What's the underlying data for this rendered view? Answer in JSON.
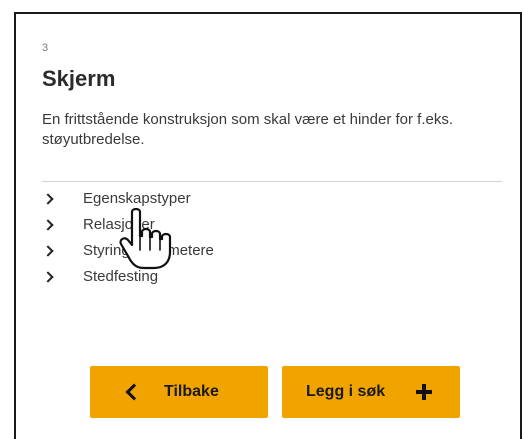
{
  "object": {
    "index": "3",
    "title": "Skjerm",
    "description": "En frittstående konstruksjon som skal være et hinder for f.eks. støyutbredelse."
  },
  "accordion": {
    "items": [
      {
        "label": "Egenskapstyper",
        "icon": "chevron-right-icon"
      },
      {
        "label": "Relasjoner",
        "icon": "chevron-right-icon"
      },
      {
        "label": "Styringsparametere",
        "icon": "chevron-right-icon"
      },
      {
        "label": "Stedfesting",
        "icon": "chevron-right-icon"
      }
    ]
  },
  "buttons": {
    "back_label": "Tilbake",
    "back_icon": "chevron-left-icon",
    "add_label": "Legg i søk",
    "add_icon": "plus-icon"
  },
  "colors": {
    "accent": "#f1a400",
    "text": "#3a3a3a",
    "heading": "#2b2b2b"
  },
  "pointer": "hand-cursor-icon"
}
